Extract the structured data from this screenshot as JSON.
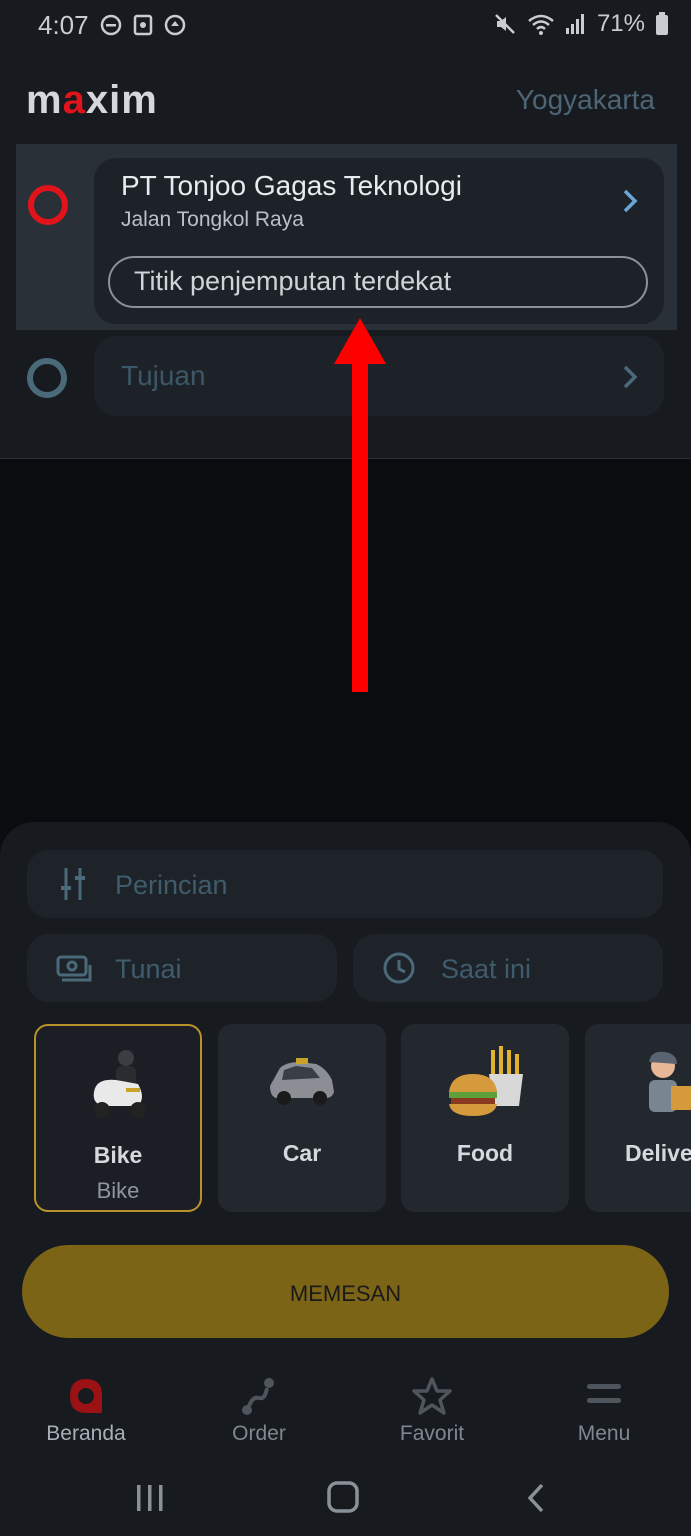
{
  "status_bar": {
    "time": "4:07",
    "battery": "71%"
  },
  "header": {
    "logo_prefix": "m",
    "logo_accent": "a",
    "logo_suffix": "xim",
    "city": "Yogyakarta"
  },
  "pickup": {
    "title": "PT Tonjoo Gagas Teknologi",
    "subtitle": "Jalan Tongkol Raya",
    "nearest_label": "Titik penjemputan terdekat"
  },
  "destination": {
    "placeholder": "Tujuan"
  },
  "options": {
    "details_label": "Perincian",
    "payment_label": "Tunai",
    "time_label": "Saat ini"
  },
  "categories": [
    {
      "label": "Bike",
      "sub": "Bike",
      "selected": true
    },
    {
      "label": "Car",
      "sub": ""
    },
    {
      "label": "Food",
      "sub": ""
    },
    {
      "label": "Delive",
      "sub": ""
    }
  ],
  "order_button": {
    "label": "MEMESAN"
  },
  "bottom_nav": [
    {
      "label": "Beranda",
      "active": true
    },
    {
      "label": "Order"
    },
    {
      "label": "Favorit"
    },
    {
      "label": "Menu"
    }
  ],
  "colors": {
    "accent_red": "#e0141a",
    "order_gold": "#7c6416",
    "link_blue": "#6aa7d8",
    "arrow_red": "#ff0000"
  }
}
